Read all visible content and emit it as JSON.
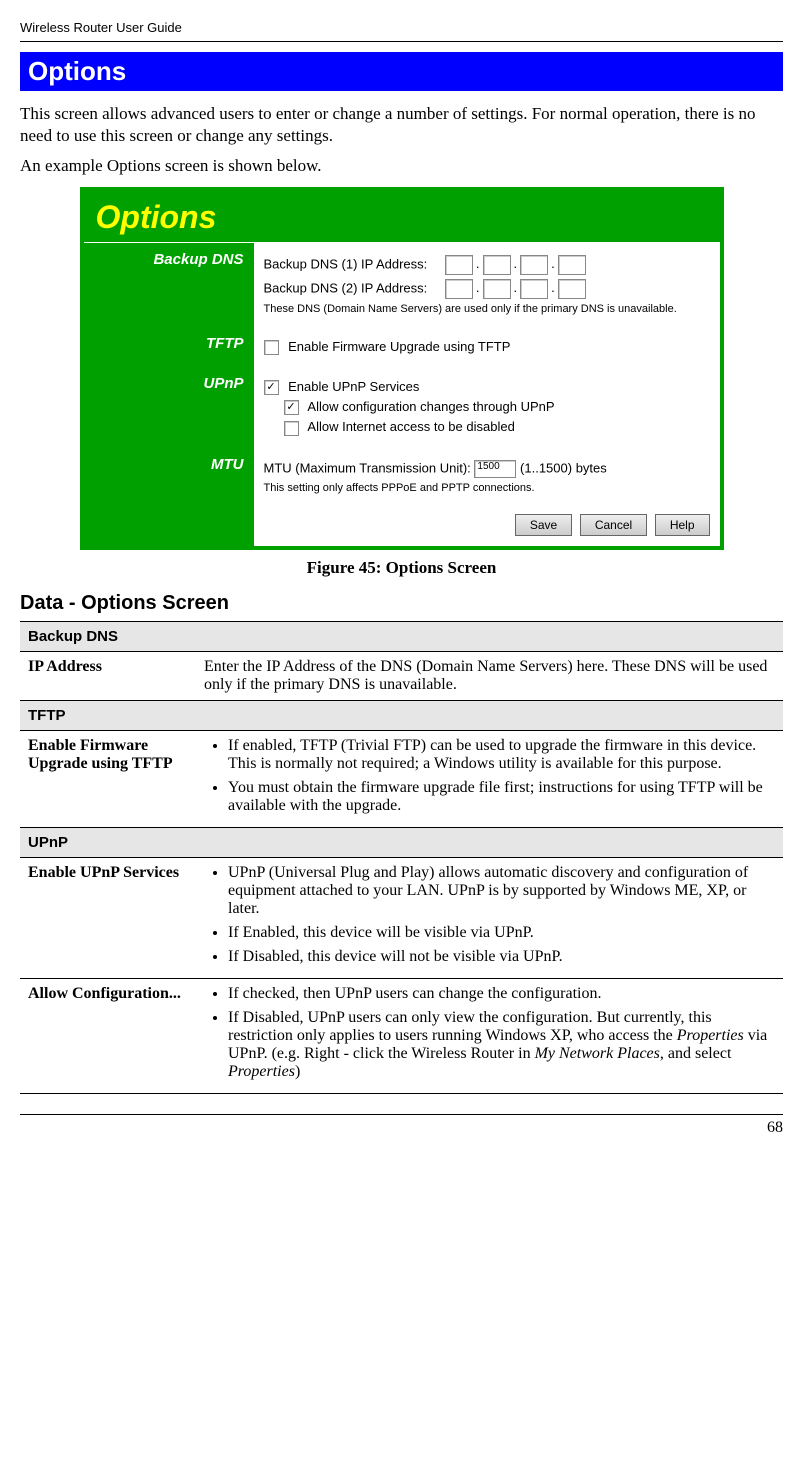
{
  "running_header": "Wireless Router User Guide",
  "title": "Options",
  "intro_p1": "This screen allows advanced users to enter or change a number of settings. For normal opera­tion, there is no need to use this screen or change any settings.",
  "intro_p2": "An example Options screen is shown below.",
  "screenshot": {
    "title": "Options",
    "sections": {
      "backup_dns": {
        "label": "Backup DNS",
        "line1": "Backup DNS (1) IP Address:",
        "line2": "Backup DNS (2) IP Address:",
        "hint": "These DNS (Domain Name Servers) are used only if the primary DNS is unavailable."
      },
      "tftp": {
        "label": "TFTP",
        "cb1": "Enable Firmware Upgrade using TFTP"
      },
      "upnp": {
        "label": "UPnP",
        "cb1": "Enable UPnP Services",
        "cb2": "Allow configuration changes through UPnP",
        "cb3": "Allow Internet access to be disabled"
      },
      "mtu": {
        "label": "MTU",
        "line": "MTU (Maximum Transmission Unit):",
        "value": "1500",
        "suffix": "(1..1500) bytes",
        "hint": "This setting only affects PPPoE and PPTP connections."
      }
    },
    "buttons": {
      "save": "Save",
      "cancel": "Cancel",
      "help": "Help"
    }
  },
  "figure_caption": "Figure 45: Options Screen",
  "data_heading": "Data - Options Screen",
  "table": {
    "group_backup_dns": "Backup DNS",
    "row_ip_address": {
      "label": "IP Address",
      "text": "Enter the IP Address of the DNS (Domain Name Servers) here. These DNS will be used only if the primary DNS is unavailable."
    },
    "group_tftp": "TFTP",
    "row_tftp": {
      "label": "Enable Firm­ware Upgrade using TFTP",
      "b1": "If enabled, TFTP (Trivial FTP) can be used to upgrade the firm­ware in this device. This is normally not required; a Windows utility is available for this purpose.",
      "b2": "You must obtain the firmware upgrade file first; instructions for using TFTP will be available with the upgrade."
    },
    "group_upnp": "UPnP",
    "row_upnp_enable": {
      "label": "Enable UPnP Services",
      "b1": "UPnP (Universal Plug and Play) allows automatic discovery and configuration of equipment attached to your LAN. UPnP is by supported by Windows ME, XP, or later.",
      "b2": "If Enabled, this device will be visible via UPnP.",
      "b3": "If Disabled, this device will not be visible via UPnP."
    },
    "row_upnp_allow": {
      "label": "Allow Configu­ration...",
      "b1": "If checked, then UPnP users can change the configuration.",
      "b2_pre": "If Disabled, UPnP users can only view the configuration. But currently, this restriction only applies to users running Windows XP, who access the ",
      "b2_i1": "Properties",
      "b2_mid": " via UPnP. (e.g. Right - click the Wireless Router in ",
      "b2_i2": "My Network Places",
      "b2_mid2": ", and select ",
      "b2_i3": "Properties",
      "b2_end": ")"
    }
  },
  "page_number": "68"
}
